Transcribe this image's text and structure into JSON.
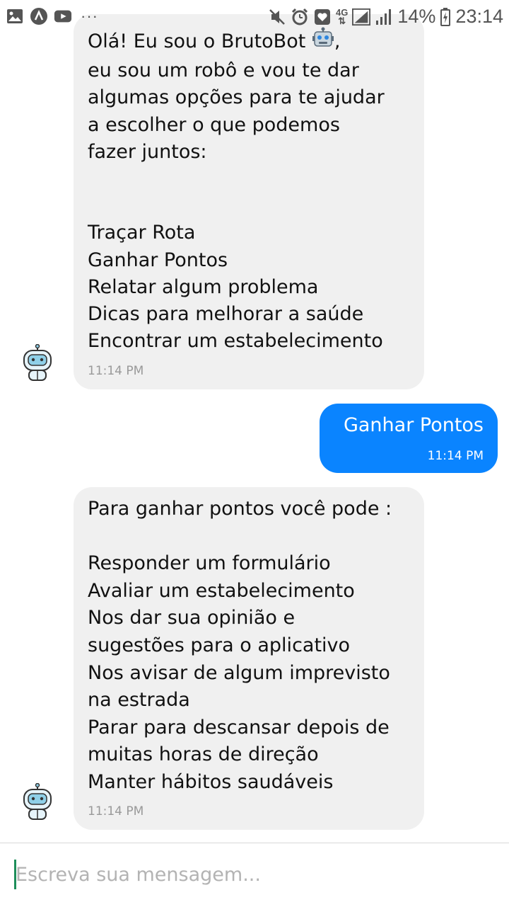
{
  "status_bar": {
    "network": "4G",
    "battery_percent": "14%",
    "time": "23:14",
    "more_indicator": "···",
    "icons": [
      "image-icon",
      "app-a-icon",
      "youtube-icon",
      "muted-icon",
      "alarm-icon",
      "heart-app-icon",
      "signal-icon",
      "signal-icon",
      "battery-charging-icon"
    ]
  },
  "messages": [
    {
      "sender": "bot",
      "intro_first": "Olá! Eu sou o BrutoBot",
      "intro_after_emoji": ",",
      "intro_lines": [
        "eu sou um robô e vou te dar",
        "algumas opções para te ajudar",
        "a escolher o que podemos",
        "fazer juntos:"
      ],
      "options": [
        "Traçar Rota",
        "Ganhar Pontos",
        "Relatar algum problema",
        "Dicas para melhorar a saúde",
        "Encontrar um estabelecimento"
      ],
      "time": "11:14 PM"
    },
    {
      "sender": "user",
      "text": "Ganhar Pontos",
      "time": "11:14 PM"
    },
    {
      "sender": "bot",
      "intro": "Para ganhar pontos você pode :",
      "lines": [
        "Responder um formulário",
        "Avaliar um estabelecimento",
        "Nos dar sua opinião e",
        "sugestões para o aplicativo",
        "Nos avisar de algum imprevisto",
        "na estrada",
        "Parar para descansar depois de",
        "muitas horas de direção",
        "Manter hábitos saudáveis"
      ],
      "time": "11:14 PM"
    }
  ],
  "composer": {
    "value": "",
    "placeholder": "Escreva sua mensagem..."
  },
  "colors": {
    "user_bubble": "#0a84ff",
    "bot_bubble": "#f0f0f0",
    "cursor": "#1e8e5a"
  }
}
